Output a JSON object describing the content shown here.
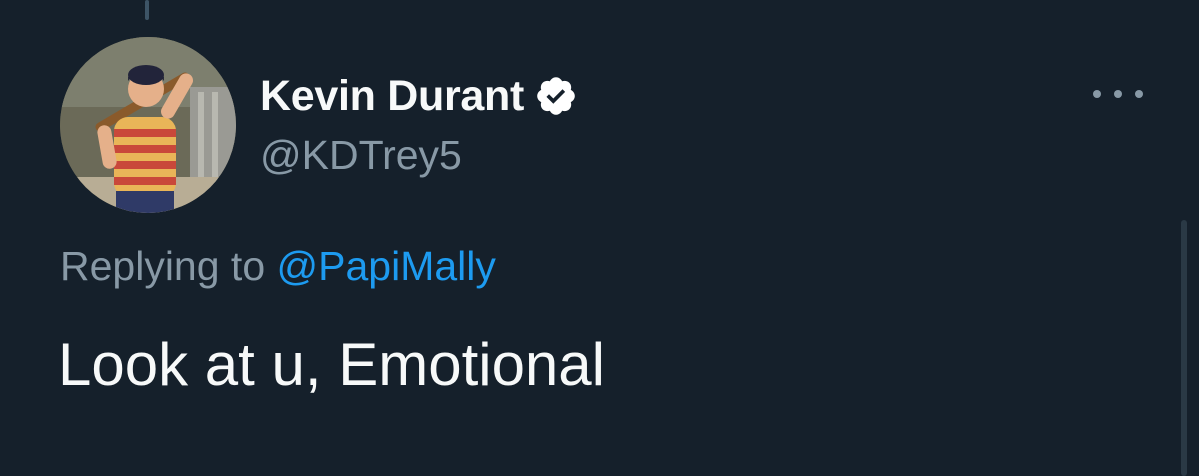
{
  "tweet": {
    "author": {
      "display_name": "Kevin Durant",
      "handle": "@KDTrey5",
      "verified": true,
      "avatar_icon": "avatar-photo"
    },
    "reply": {
      "prefix": "Replying to",
      "mention": "@PapiMally"
    },
    "text": "Look at u, Emotional",
    "more_icon": "more-horizontal-icon"
  },
  "colors": {
    "background": "#15202b",
    "primary_text": "#f7f9f9",
    "secondary_text": "#8899a6",
    "link": "#1d9bf0",
    "verified_badge": "#ffffff"
  }
}
